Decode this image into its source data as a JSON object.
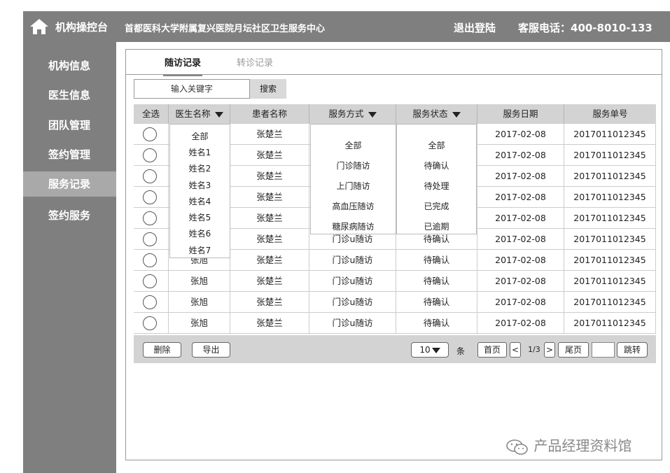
{
  "header": {
    "brand": "机构操控台",
    "org_name": "首都医科大学附属复兴医院月坛社区卫生服务中心",
    "logout": "退出登陆",
    "phone": "客服电话：400-8010-133",
    "home_icon": "home-icon"
  },
  "sidebar": {
    "items": [
      {
        "label": "机构信息",
        "active": false
      },
      {
        "label": "医生信息",
        "active": false
      },
      {
        "label": "团队管理",
        "active": false
      },
      {
        "label": "签约管理",
        "active": false
      },
      {
        "label": "服务记录",
        "active": true
      },
      {
        "label": "签约服务",
        "active": false
      }
    ]
  },
  "tabs": [
    {
      "label": "随访记录",
      "active": true
    },
    {
      "label": "转诊记录",
      "active": false
    }
  ],
  "search": {
    "placeholder": "输入关键字",
    "button": "搜索"
  },
  "table": {
    "headers": [
      "全选",
      "医生名称",
      "患者名称",
      "服务方式",
      "服务状态",
      "服务日期",
      "服务单号"
    ],
    "rows": [
      {
        "doctor": "",
        "patient": "张楚兰",
        "method": "",
        "status": "",
        "date": "2017-02-08",
        "id": "2017011012345"
      },
      {
        "doctor": "",
        "patient": "张楚兰",
        "method": "",
        "status": "",
        "date": "2017-02-08",
        "id": "2017011012345"
      },
      {
        "doctor": "",
        "patient": "张楚兰",
        "method": "",
        "status": "",
        "date": "2017-02-08",
        "id": "2017011012345"
      },
      {
        "doctor": "",
        "patient": "张楚兰",
        "method": "",
        "status": "",
        "date": "2017-02-08",
        "id": "2017011012345"
      },
      {
        "doctor": "",
        "patient": "张楚兰",
        "method": "",
        "status": "",
        "date": "2017-02-08",
        "id": "2017011012345"
      },
      {
        "doctor": "",
        "patient": "张楚兰",
        "method": "门诊u随访",
        "status": "待确认",
        "date": "2017-02-08",
        "id": "2017011012345"
      },
      {
        "doctor": "张旭",
        "patient": "张楚兰",
        "method": "门诊u随访",
        "status": "待确认",
        "date": "2017-02-08",
        "id": "2017011012345"
      },
      {
        "doctor": "张旭",
        "patient": "张楚兰",
        "method": "门诊u随访",
        "status": "待确认",
        "date": "2017-02-08",
        "id": "2017011012345"
      },
      {
        "doctor": "张旭",
        "patient": "张楚兰",
        "method": "门诊u随访",
        "status": "待确认",
        "date": "2017-02-08",
        "id": "2017011012345"
      },
      {
        "doctor": "张旭",
        "patient": "张楚兰",
        "method": "门诊u随访",
        "status": "待确认",
        "date": "2017-02-08",
        "id": "2017011012345"
      }
    ]
  },
  "dropdowns": {
    "doctor": [
      "全部",
      "姓名1",
      "姓名2",
      "姓名3",
      "姓名4",
      "姓名5",
      "姓名6",
      "姓名7"
    ],
    "method": [
      "全部",
      "门诊随访",
      "上门随访",
      "高血压随访",
      "糖尿病随访"
    ],
    "status": [
      "全部",
      "待确认",
      "待处理",
      "已完成",
      "已逾期"
    ]
  },
  "footer": {
    "delete": "删除",
    "export": "导出",
    "page_size": "10",
    "page_size_unit": "条",
    "first": "首页",
    "prev": "<",
    "page_info": "1/3",
    "next": ">",
    "last": "尾页",
    "jump_value": "",
    "jump": "跳转"
  },
  "watermark": "产品经理资料馆"
}
